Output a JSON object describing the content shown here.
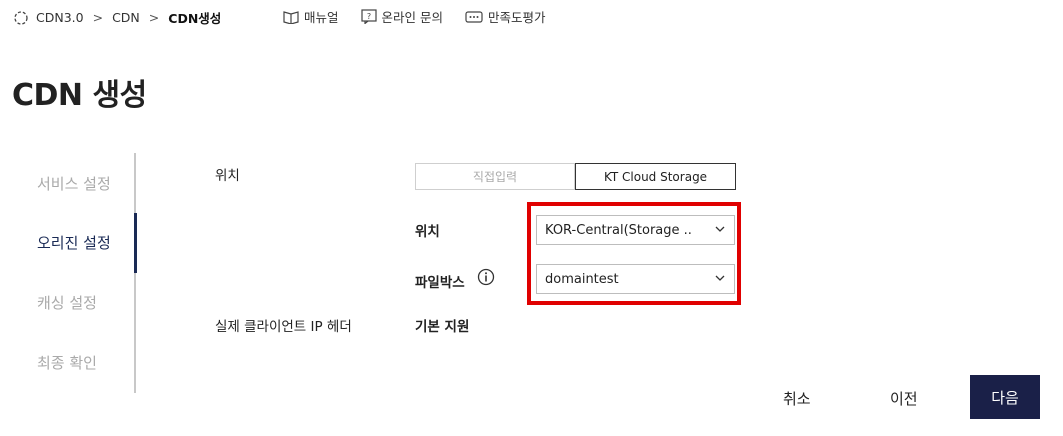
{
  "breadcrumb": {
    "items": [
      "CDN3.0",
      "CDN",
      "CDN생성"
    ],
    "separator": ">"
  },
  "toplinks": {
    "manual": "매뉴얼",
    "inquiry": "온라인 문의",
    "survey": "만족도평가"
  },
  "page": {
    "title": "CDN 생성"
  },
  "steps": [
    {
      "label": "서비스 설정",
      "active": false
    },
    {
      "label": "오리진 설정",
      "active": true
    },
    {
      "label": "캐싱 설정",
      "active": false
    },
    {
      "label": "최종 확인",
      "active": false
    }
  ],
  "form": {
    "location_label": "위치",
    "toggle": {
      "direct": "직접입력",
      "storage": "KT Cloud Storage",
      "selected": "KT Cloud Storage"
    },
    "storage_location_label": "위치",
    "storage_location_value": "KOR-Central(Storage ..",
    "filebox_label": "파일박스",
    "filebox_value": "domaintest",
    "client_ip_label": "실제 클라이언트 IP 헤더",
    "client_ip_value": "기본 지원"
  },
  "actions": {
    "cancel": "취소",
    "prev": "이전",
    "next": "다음"
  },
  "colors": {
    "accent": "#1a2048",
    "highlight": "#e00000",
    "inactive": "#aaaaaa"
  }
}
